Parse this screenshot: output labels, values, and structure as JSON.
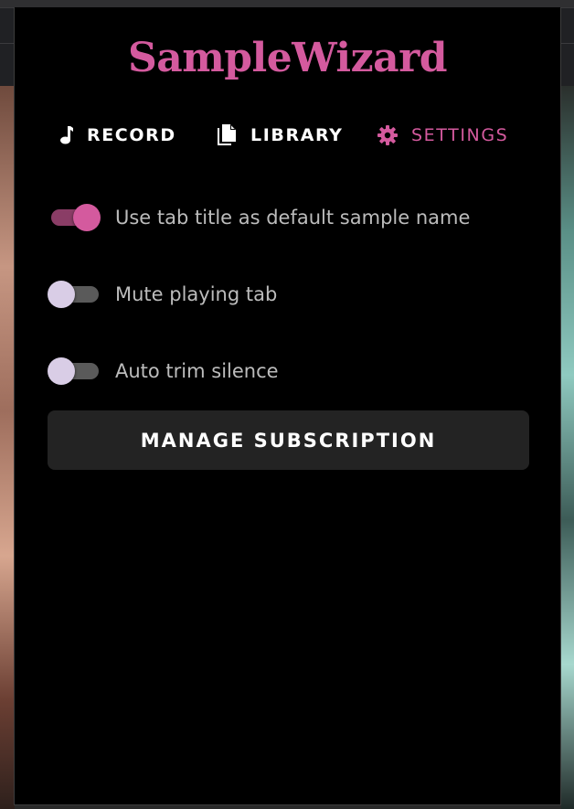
{
  "app": {
    "title": "SampleWizard",
    "brand_color": "#d45a9e"
  },
  "nav": {
    "record_label": "RECORD",
    "library_label": "LIBRARY",
    "settings_label": "SETTINGS",
    "active_tab": "SETTINGS",
    "icons": {
      "record": "music-note-icon",
      "library": "file-copy-icon",
      "settings": "gear-icon"
    }
  },
  "settings": {
    "toggles": [
      {
        "label": "Use tab title as default sample name",
        "checked": true
      },
      {
        "label": "Mute playing tab",
        "checked": false
      },
      {
        "label": "Auto trim silence",
        "checked": false
      }
    ],
    "manage_subscription_label": "MANAGE SUBSCRIPTION"
  }
}
